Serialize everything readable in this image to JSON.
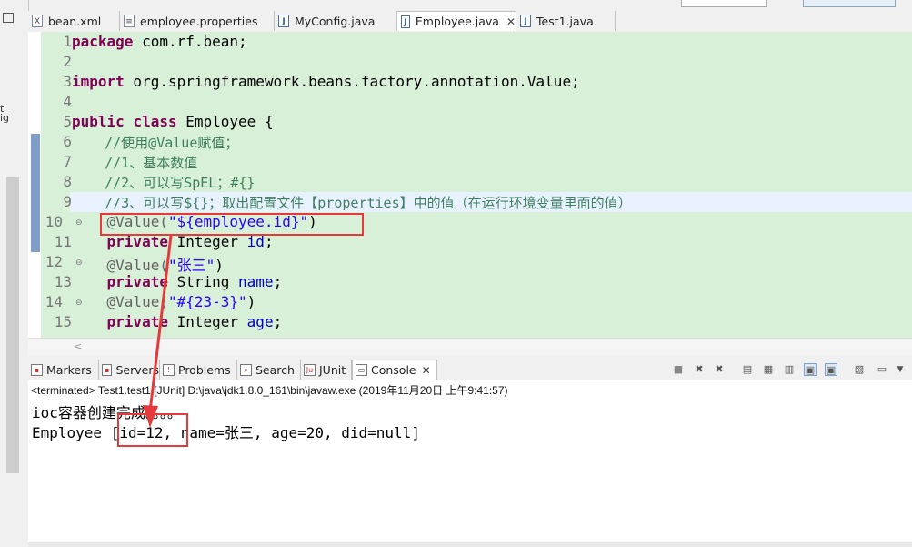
{
  "left_fragments": [
    "t",
    "ig"
  ],
  "editor_tabs": [
    {
      "label": "bean.xml",
      "icon": "X"
    },
    {
      "label": "employee.properties",
      "icon": "≡"
    },
    {
      "label": "MyConfig.java",
      "icon": "J"
    },
    {
      "label": "Employee.java",
      "icon": "J",
      "close": "✕"
    },
    {
      "label": "Test1.java",
      "icon": "J"
    }
  ],
  "code_lines": [
    {
      "num": "1"
    },
    {
      "num": "2"
    },
    {
      "num": "3"
    },
    {
      "num": "4"
    },
    {
      "num": "5"
    },
    {
      "num": "6"
    },
    {
      "num": "7"
    },
    {
      "num": "8"
    },
    {
      "num": "9"
    },
    {
      "num": "10"
    },
    {
      "num": "11"
    },
    {
      "num": "12"
    },
    {
      "num": "13"
    },
    {
      "num": "14"
    },
    {
      "num": "15"
    }
  ],
  "code": {
    "l1_kw": "package",
    "l1_rest": " com.rf.bean;",
    "l3_kw": "import",
    "l3_rest": " org.springframework.beans.factory.annotation.Value;",
    "l5_kw1": "public",
    "l5_kw2": "class",
    "l5_rest": " Employee {",
    "l6": "    //使用@Value赋值；",
    "l7": "    //1、基本数值",
    "l8": "    //2、可以写SpEL；#{}",
    "l9": "    //3、可以写${}；取出配置文件【properties】中的值（在运行环境变量里面的值）",
    "l10_an": "    @Value(",
    "l10_st": "\"${employee.id}\"",
    "l10_end": ")",
    "l11_kw": "    private",
    "l11_type": " Integer ",
    "l11_fd": "id",
    "l11_end": ";",
    "l12_an": "    @Value(",
    "l12_st": "\"张三\"",
    "l12_end": ")",
    "l13_kw": "    private",
    "l13_type": " String ",
    "l13_fd": "name",
    "l13_end": ";",
    "l14_an": "    @Value(",
    "l14_st": "\"#{23-3}\"",
    "l14_end": ")",
    "l15_kw": "    private",
    "l15_type": " Integer ",
    "l15_fd": "age",
    "l15_end": ";"
  },
  "view_tabs": [
    {
      "label": "Markers"
    },
    {
      "label": "Servers"
    },
    {
      "label": "Problems"
    },
    {
      "label": "Search"
    },
    {
      "label": "JUnit"
    },
    {
      "label": "Console",
      "close": "✕"
    }
  ],
  "console": {
    "status": "<terminated> Test1.test1 [JUnit] D:\\java\\jdk1.8.0_161\\bin\\javaw.exe (2019年11月20日 上午9:41:57)",
    "line1": "ioc容器创建完成。。。。",
    "line2": "Employee [id=12, name=张三, age=20, did=null]"
  },
  "colors": {
    "annotation_red": "#e6393b",
    "keyword": "#7f0055",
    "comment": "#3f7f5f",
    "string": "#2a00ff",
    "field": "#0000c0"
  }
}
